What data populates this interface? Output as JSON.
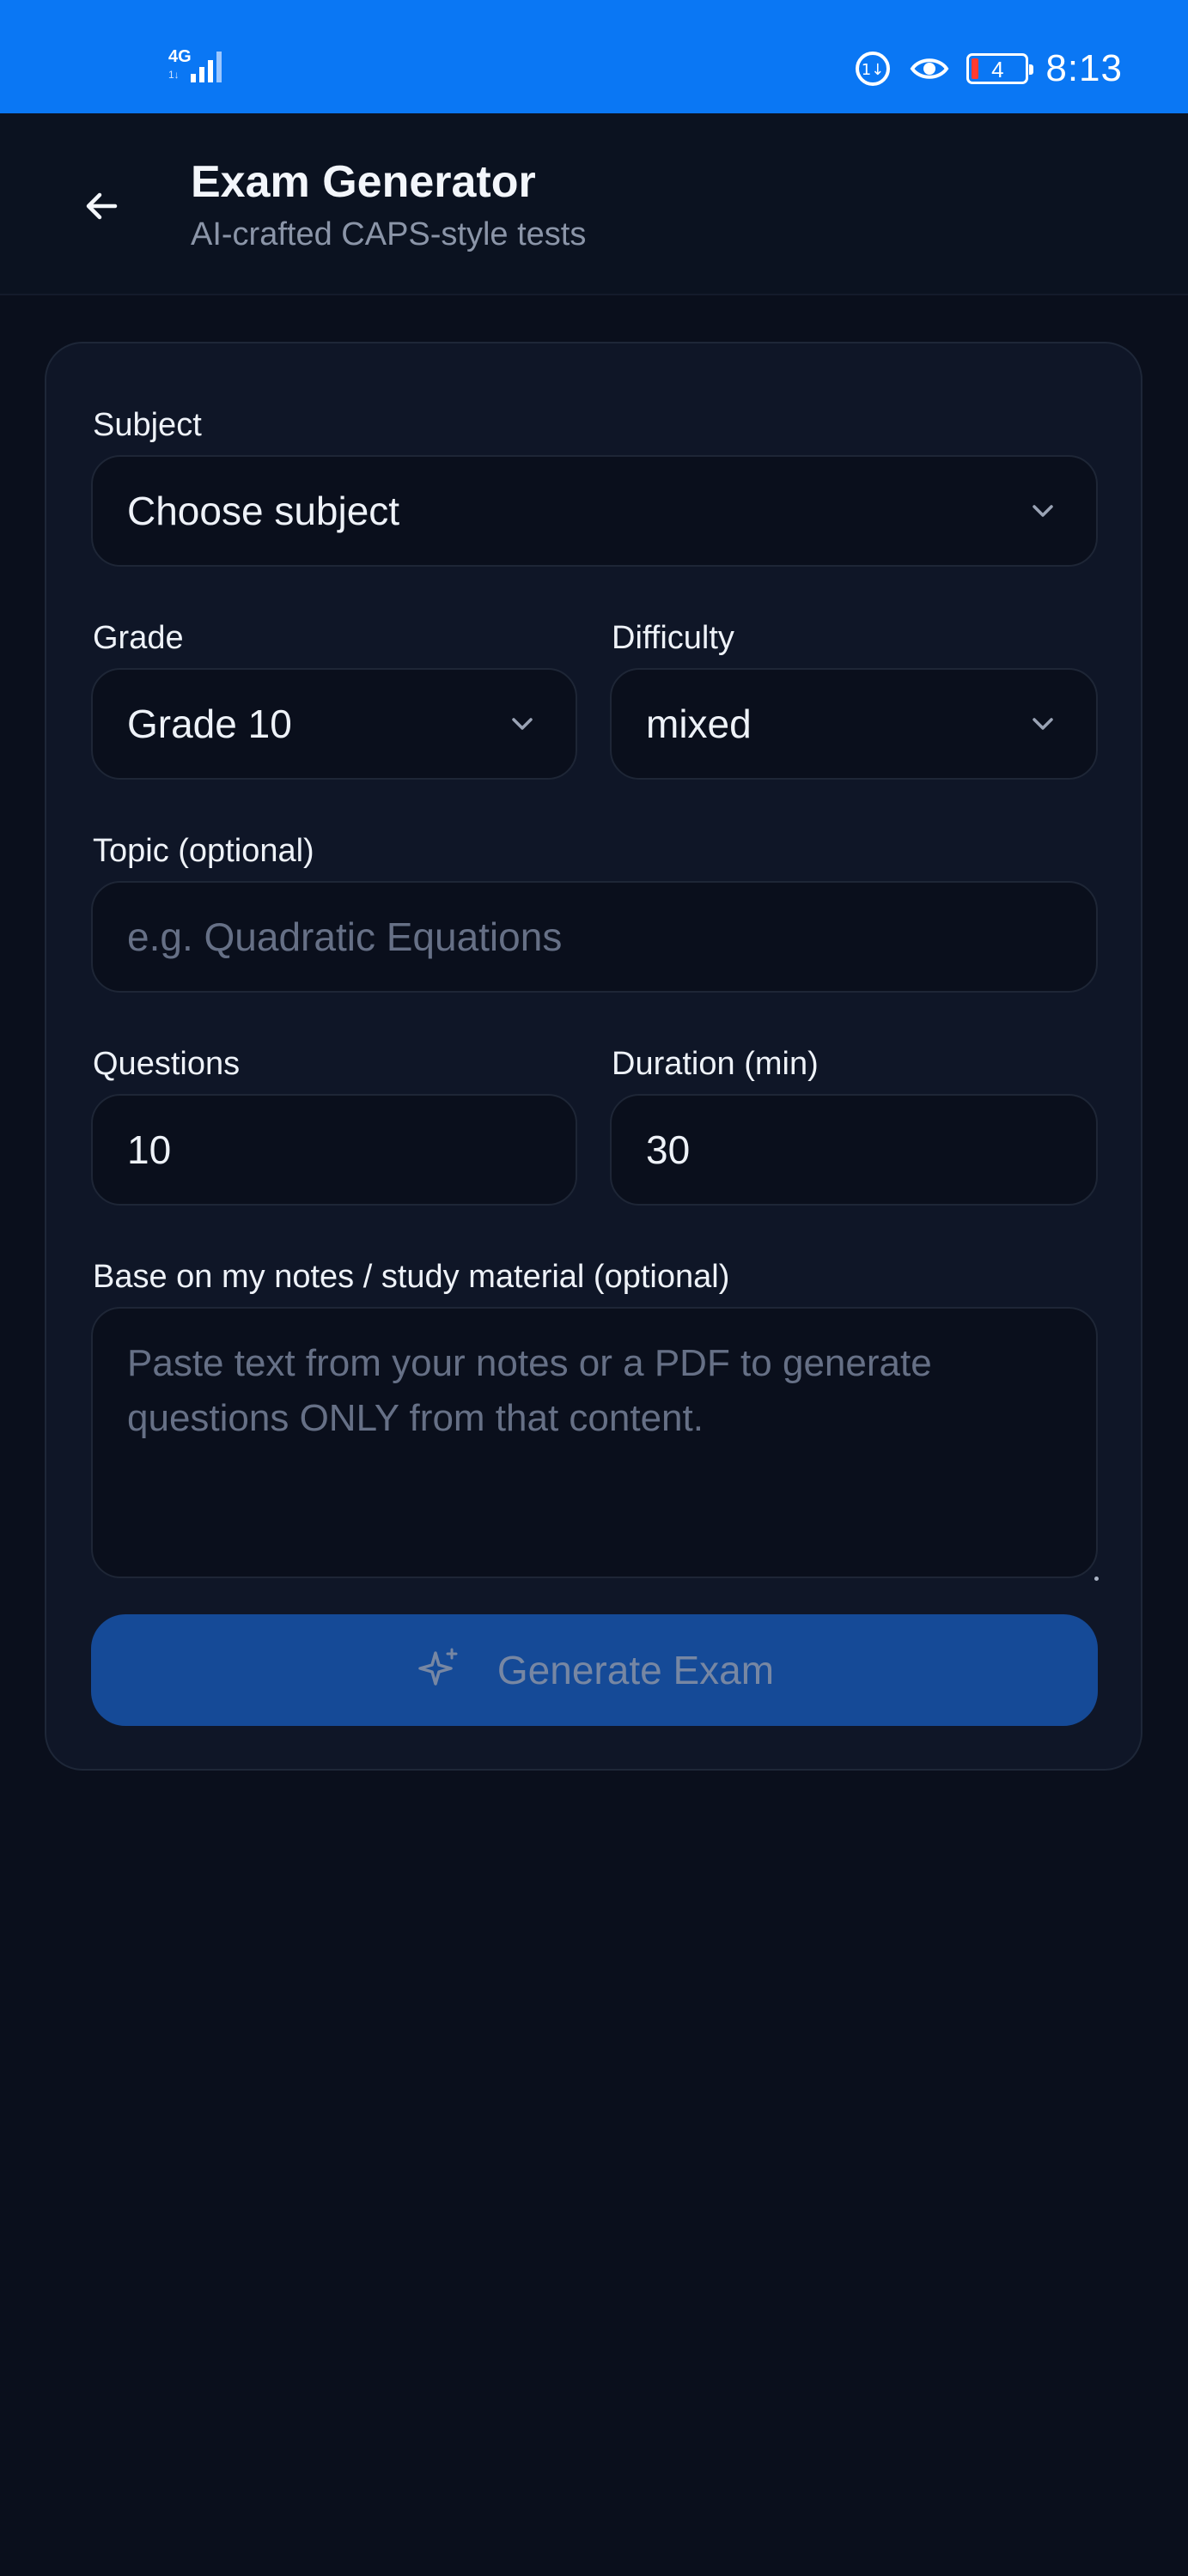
{
  "status_bar": {
    "network": "4G",
    "network_sub": "1↓",
    "battery_level": "4",
    "time": "8:13",
    "icons": [
      "data-saver-icon",
      "eye-icon",
      "battery-icon"
    ]
  },
  "header": {
    "title": "Exam Generator",
    "subtitle": "AI-crafted CAPS-style tests",
    "back_icon": "arrow-left-icon"
  },
  "form": {
    "subject": {
      "label": "Subject",
      "value": "Choose subject"
    },
    "grade": {
      "label": "Grade",
      "value": "Grade 10"
    },
    "difficulty": {
      "label": "Difficulty",
      "value": "mixed"
    },
    "topic": {
      "label": "Topic (optional)",
      "placeholder": "e.g. Quadratic Equations",
      "value": ""
    },
    "questions": {
      "label": "Questions",
      "value": "10"
    },
    "duration": {
      "label": "Duration (min)",
      "value": "30"
    },
    "notes": {
      "label": "Base on my notes / study material (optional)",
      "placeholder": "Paste text from your notes or a PDF to generate questions ONLY from that content."
    },
    "generate_button": {
      "label": "Generate Exam",
      "icon": "sparkle-icon"
    }
  },
  "colors": {
    "status_bar": "#0a77f4",
    "background": "#0a0f1c",
    "card": "#0f1627",
    "button": "#154a97"
  }
}
